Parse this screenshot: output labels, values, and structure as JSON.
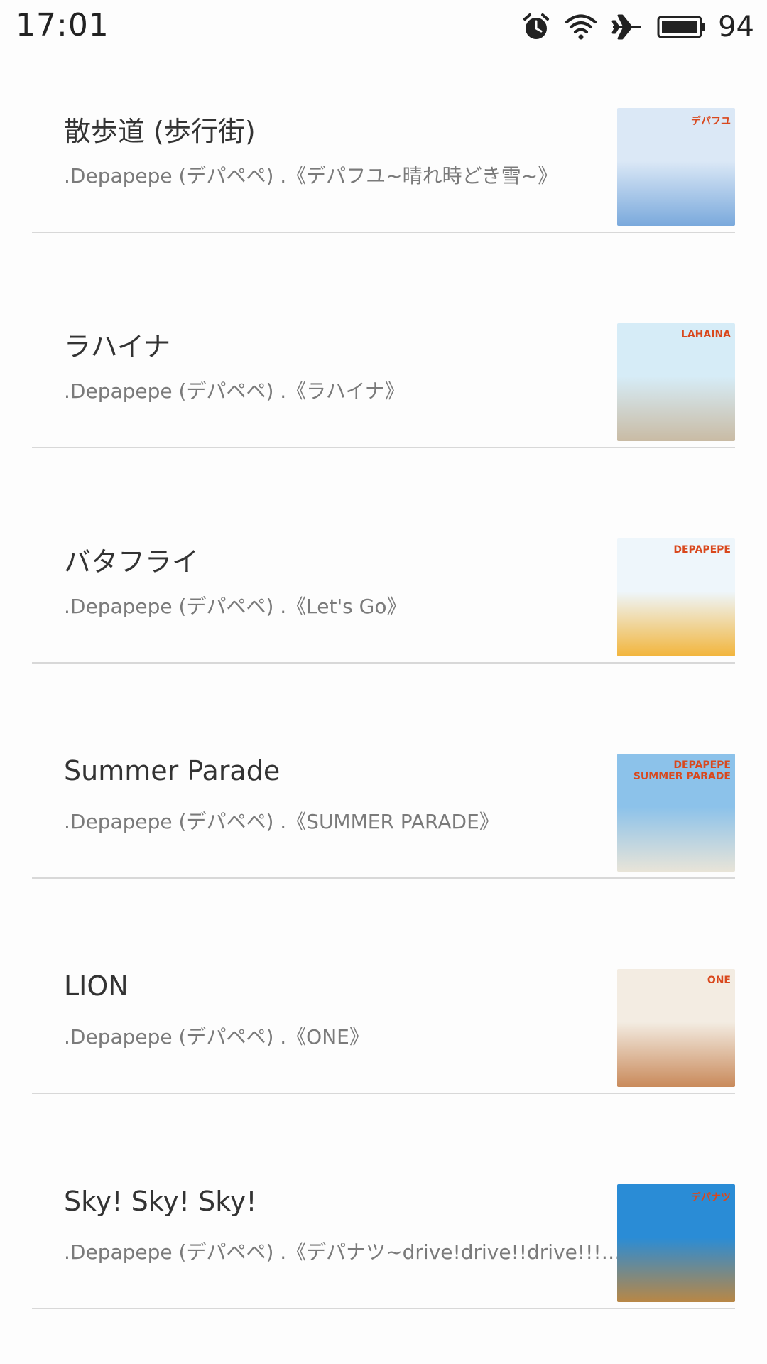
{
  "status_bar": {
    "time": "17:01",
    "battery": "94",
    "icons": [
      "alarm-icon",
      "wifi-icon",
      "airplane-icon",
      "battery-icon"
    ]
  },
  "songs": [
    {
      "title": "散歩道 (歩行街)",
      "subtitle": ".Depapepe (デパペペ) .《デパフユ~晴れ時どき雪~》",
      "cover_text": "デパフユ",
      "cover_colors": [
        "#dbe8f6",
        "#7aa9dc"
      ]
    },
    {
      "title": "ラハイナ",
      "subtitle": ".Depapepe (デパペペ) .《ラハイナ》",
      "cover_text": "LAHAINA",
      "cover_colors": [
        "#d6ecf7",
        "#c9bba4"
      ]
    },
    {
      "title": "バタフライ",
      "subtitle": ".Depapepe (デパペペ) .《Let's Go》",
      "cover_text": "DEPAPEPE",
      "cover_colors": [
        "#eef6fb",
        "#f2b53c"
      ]
    },
    {
      "title": "Summer Parade",
      "subtitle": ".Depapepe (デパペペ) .《SUMMER PARADE》",
      "cover_text": "DEPAPEPE SUMMER PARADE",
      "cover_colors": [
        "#8cc2ea",
        "#e8e4d8"
      ]
    },
    {
      "title": "LION",
      "subtitle": ".Depapepe (デパペペ) .《ONE》",
      "cover_text": "ONE",
      "cover_colors": [
        "#f3ece2",
        "#c98a5b"
      ]
    },
    {
      "title": "Sky! Sky! Sky!",
      "subtitle": ".Depapepe (デパペペ) .《デパナツ~drive!drive!!drive!!!~》",
      "cover_text": "デパナツ",
      "cover_colors": [
        "#2a8cd6",
        "#b98745"
      ]
    }
  ]
}
